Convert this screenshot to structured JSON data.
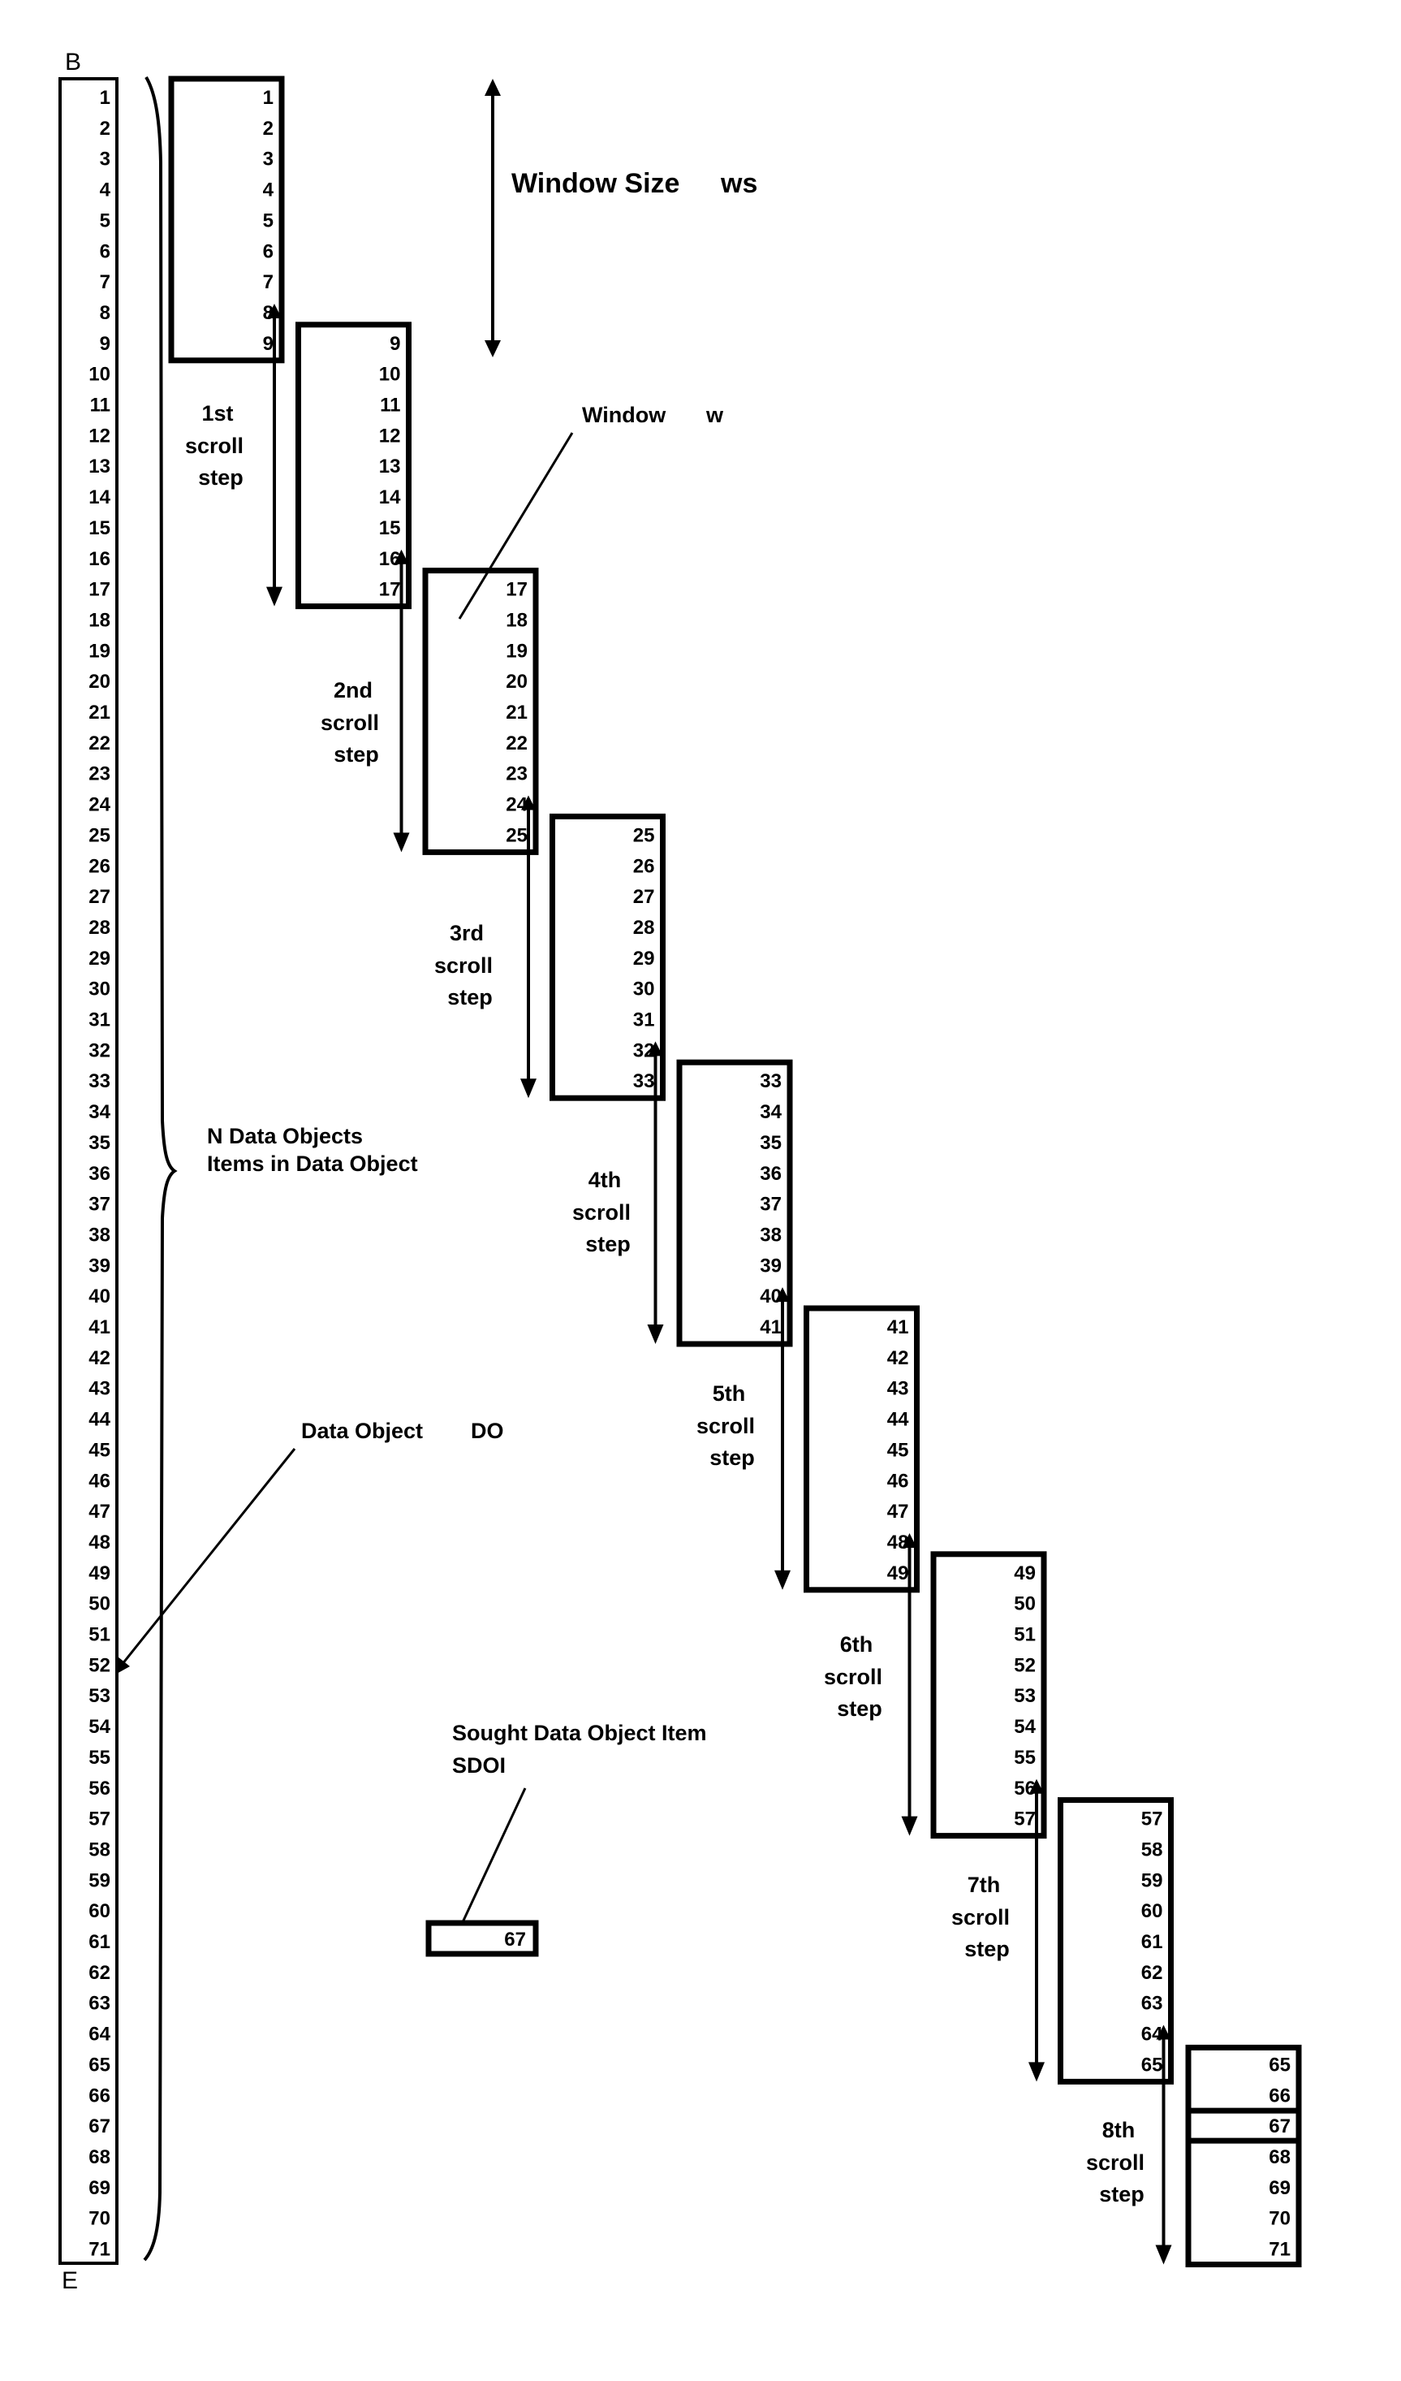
{
  "figure": {
    "begin_marker": "B",
    "end_marker": "E",
    "data_object": {
      "items": [
        1,
        2,
        3,
        4,
        5,
        6,
        7,
        8,
        9,
        10,
        11,
        12,
        13,
        14,
        15,
        16,
        17,
        18,
        19,
        20,
        21,
        22,
        23,
        24,
        25,
        26,
        27,
        28,
        29,
        30,
        31,
        32,
        33,
        34,
        35,
        36,
        37,
        38,
        39,
        40,
        41,
        42,
        43,
        44,
        45,
        46,
        47,
        48,
        49,
        50,
        51,
        52,
        53,
        54,
        55,
        56,
        57,
        58,
        59,
        60,
        61,
        62,
        63,
        64,
        65,
        66,
        67,
        68,
        69,
        70,
        71
      ],
      "item_count": 71
    },
    "window_size": 9,
    "scroll_increment": 8,
    "windows": [
      {
        "step": "1st",
        "items": [
          1,
          2,
          3,
          4,
          5,
          6,
          7,
          8,
          9
        ]
      },
      {
        "step": "2nd",
        "items": [
          9,
          10,
          11,
          12,
          13,
          14,
          15,
          16,
          17
        ]
      },
      {
        "step": "3rd",
        "items": [
          17,
          18,
          19,
          20,
          21,
          22,
          23,
          24,
          25
        ]
      },
      {
        "step": "4th",
        "items": [
          25,
          26,
          27,
          28,
          29,
          30,
          31,
          32,
          33
        ]
      },
      {
        "step": "5th",
        "items": [
          33,
          34,
          35,
          36,
          37,
          38,
          39,
          40,
          41
        ]
      },
      {
        "step": "6th",
        "items": [
          41,
          42,
          43,
          44,
          45,
          46,
          47,
          48,
          49
        ]
      },
      {
        "step": "7th",
        "items": [
          49,
          50,
          51,
          52,
          53,
          54,
          55,
          56,
          57
        ]
      },
      {
        "step": "8th",
        "items": [
          57,
          58,
          59,
          60,
          61,
          62,
          63,
          64,
          65
        ]
      }
    ],
    "final_window": {
      "items": [
        65,
        66,
        67,
        68,
        69,
        70,
        71
      ],
      "highlighted_item": 67
    },
    "scroll_steps": [
      {
        "ordinal": "1st",
        "word1": "scroll",
        "word2": "step"
      },
      {
        "ordinal": "2nd",
        "word1": "scroll",
        "word2": "step"
      },
      {
        "ordinal": "3rd",
        "word1": "scroll",
        "word2": "step"
      },
      {
        "ordinal": "4th",
        "word1": "scroll",
        "word2": "step"
      },
      {
        "ordinal": "5th",
        "word1": "scroll",
        "word2": "step"
      },
      {
        "ordinal": "6th",
        "word1": "scroll",
        "word2": "step"
      },
      {
        "ordinal": "7th",
        "word1": "scroll",
        "word2": "step"
      },
      {
        "ordinal": "8th",
        "word1": "scroll",
        "word2": "step"
      }
    ],
    "labels": {
      "window_size": "Window Size",
      "window_size_symbol": "ws",
      "window": "Window",
      "window_symbol": "w",
      "n_data_objects": "N Data Objects",
      "items_in_data_object": "Items in Data Object",
      "data_object": "Data Object",
      "data_object_symbol": "DO",
      "sought_item": "Sought Data Object Item",
      "sought_item_symbol": "SDOI"
    },
    "sought_item_value": 67
  }
}
